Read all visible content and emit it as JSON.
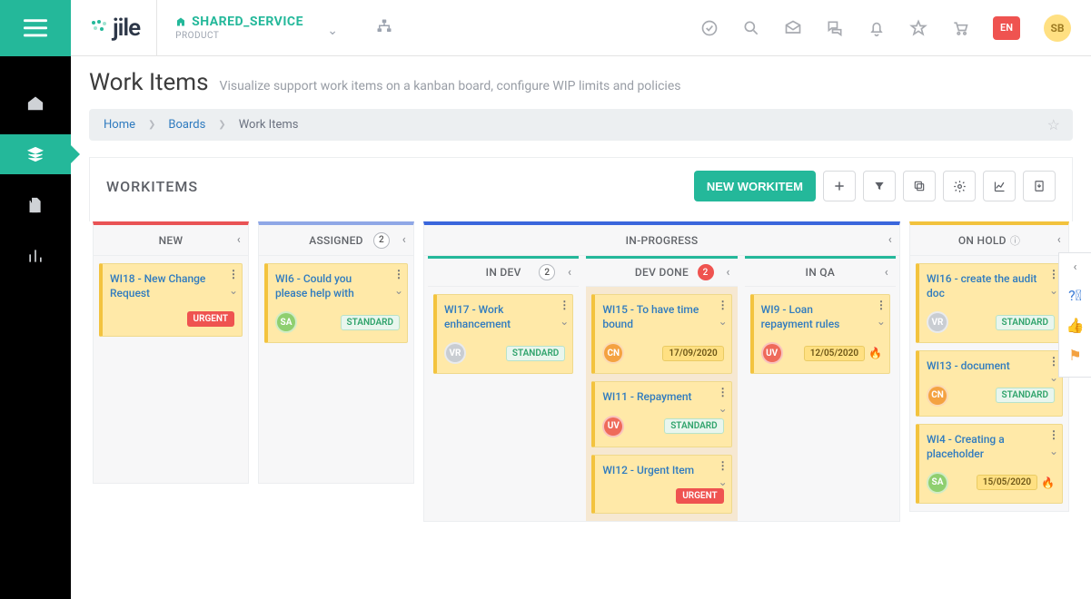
{
  "header": {
    "logo_text": "jile",
    "product_name": "SHARED_SERVICE",
    "product_sub": "PRODUCT",
    "lang": "EN",
    "user_initials": "SB"
  },
  "page": {
    "title": "Work Items",
    "subtitle": "Visualize support work items on a kanban board, configure WIP limits and policies",
    "breadcrumbs": {
      "home": "Home",
      "boards": "Boards",
      "current": "Work Items"
    }
  },
  "board": {
    "heading": "WORKITEMS",
    "new_button": "NEW WORKITEM",
    "columns": {
      "new": {
        "label": "NEW"
      },
      "assigned": {
        "label": "ASSIGNED",
        "wip": "2"
      },
      "inprogress": {
        "label": "IN-PROGRESS",
        "sub": {
          "indev": {
            "label": "IN DEV",
            "wip": "2"
          },
          "devdone": {
            "label": "DEV DONE",
            "wip": "2",
            "over": true
          },
          "inqa": {
            "label": "IN QA"
          }
        }
      },
      "onhold": {
        "label": "ON HOLD"
      }
    },
    "cards": {
      "new": [
        {
          "title": "WI18 - New Change Request",
          "tag": "URGENT",
          "tagClass": "tag-urgent"
        }
      ],
      "assigned": [
        {
          "title": "WI6 - Could you please help with",
          "assignee": "SA",
          "assigneeColor": "#8fcf6f",
          "tag": "STANDARD",
          "tagClass": "tag-standard"
        }
      ],
      "indev": [
        {
          "title": "WI17 - Work enhancement",
          "assignee": "VR",
          "assigneeColor": "#c9cdd2",
          "tag": "STANDARD",
          "tagClass": "tag-standard"
        }
      ],
      "devdone": [
        {
          "title": "WI15 - To have time bound",
          "assignee": "CN",
          "assigneeColor": "#f4a241",
          "date": "17/09/2020"
        },
        {
          "title": "WI11 - Repayment",
          "assignee": "UV",
          "assigneeColor": "#ef6a5a",
          "tag": "STANDARD",
          "tagClass": "tag-standard"
        },
        {
          "title": "WI12 - Urgent Item",
          "tag": "URGENT",
          "tagClass": "tag-urgent"
        }
      ],
      "inqa": [
        {
          "title": "WI9 - Loan repayment rules",
          "assignee": "UV",
          "assigneeColor": "#ef6a5a",
          "date": "12/05/2020",
          "flame": true
        }
      ],
      "onhold": [
        {
          "title": "WI16 - create the audit doc",
          "assignee": "VR",
          "assigneeColor": "#c9cdd2",
          "tag": "STANDARD",
          "tagClass": "tag-standard"
        },
        {
          "title": "WI13 - document",
          "assignee": "CN",
          "assigneeColor": "#f4a241",
          "tag": "STANDARD",
          "tagClass": "tag-standard"
        },
        {
          "title": "WI4 - Creating a placeholder",
          "assignee": "SA",
          "assigneeColor": "#8fcf6f",
          "date": "15/05/2020",
          "flame": true
        }
      ]
    }
  }
}
